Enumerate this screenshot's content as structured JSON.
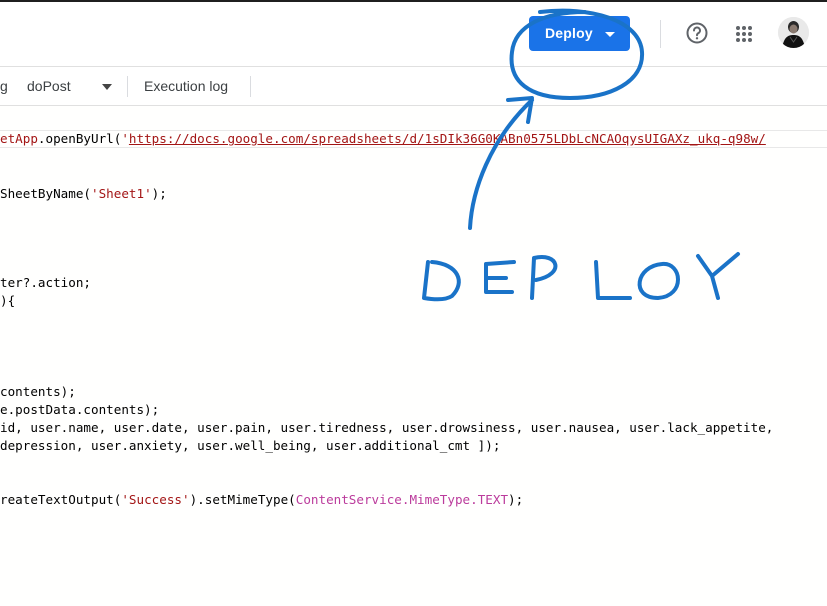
{
  "header": {
    "deploy_label": "Deploy",
    "help_icon": "help-circle-icon",
    "apps_icon": "google-apps-icon",
    "avatar": "user-avatar"
  },
  "toolbar": {
    "left_fragment": "g",
    "function_name": "doPost",
    "execution_log_label": "Execution log"
  },
  "code": {
    "line1": {
      "a": "etApp",
      "b": ".openByUrl(",
      "c": "'",
      "url": "https://docs.google.com/spreadsheets/d/1sDIk36G0KABn0575LDbLcNCAOqysUIGAXz_ukq-q98w/"
    },
    "line2": {
      "a": "SheetByName(",
      "s": "'Sheet1'",
      "b": ");"
    },
    "line3": "ter?.action;",
    "line4": "){",
    "line5": "contents);",
    "line6": "e.postData.contents);",
    "line7": "id, user.name, user.date, user.pain, user.tiredness, user.drowsiness, user.nausea, user.lack_appetite,",
    "line8": "depression, user.anxiety, user.well_being, user.additional_cmt ]);",
    "line9": {
      "a": "reateTextOutput(",
      "s": "'Success'",
      "b": ").setMimeType(",
      "c": "ContentService.MimeType.TEXT",
      "d": ");"
    }
  },
  "annotation": {
    "text": "DEPLOY",
    "color": "#1a73c8"
  },
  "colors": {
    "accent": "#1a73e8",
    "string": "#a31515",
    "class": "#bb3b9c"
  }
}
